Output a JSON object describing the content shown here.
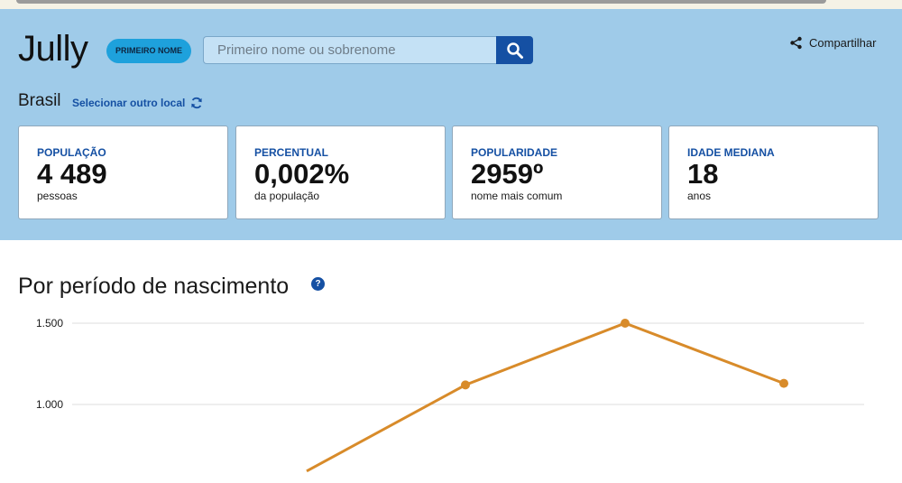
{
  "header": {
    "name": "Jully",
    "badge": "PRIMEIRO NOME",
    "search_placeholder": "Primeiro nome ou sobrenome",
    "share_label": "Compartilhar"
  },
  "location": {
    "name": "Brasil",
    "change_label": "Selecionar outro local"
  },
  "stats": [
    {
      "label": "POPULAÇÃO",
      "value": "4 489",
      "sub": "pessoas"
    },
    {
      "label": "PERCENTUAL",
      "value": "0,002%",
      "sub": "da população"
    },
    {
      "label": "POPULARIDADE",
      "value": "2959º",
      "sub": "nome mais comum"
    },
    {
      "label": "IDADE MEDIANA",
      "value": "18",
      "sub": "anos"
    }
  ],
  "section": {
    "title": "Por período de nascimento"
  },
  "colors": {
    "hero_bg": "#9fcbe9",
    "accent_blue": "#1550a3",
    "series": "#d88b2a"
  },
  "chart_data": {
    "type": "line",
    "title": "",
    "yticks": [
      "1.500",
      "1.000"
    ],
    "ytick_values": [
      1500,
      1000
    ],
    "ylim": [
      0,
      1500
    ],
    "series": [
      {
        "values": [
          590,
          1120,
          1500,
          1130
        ]
      }
    ]
  }
}
